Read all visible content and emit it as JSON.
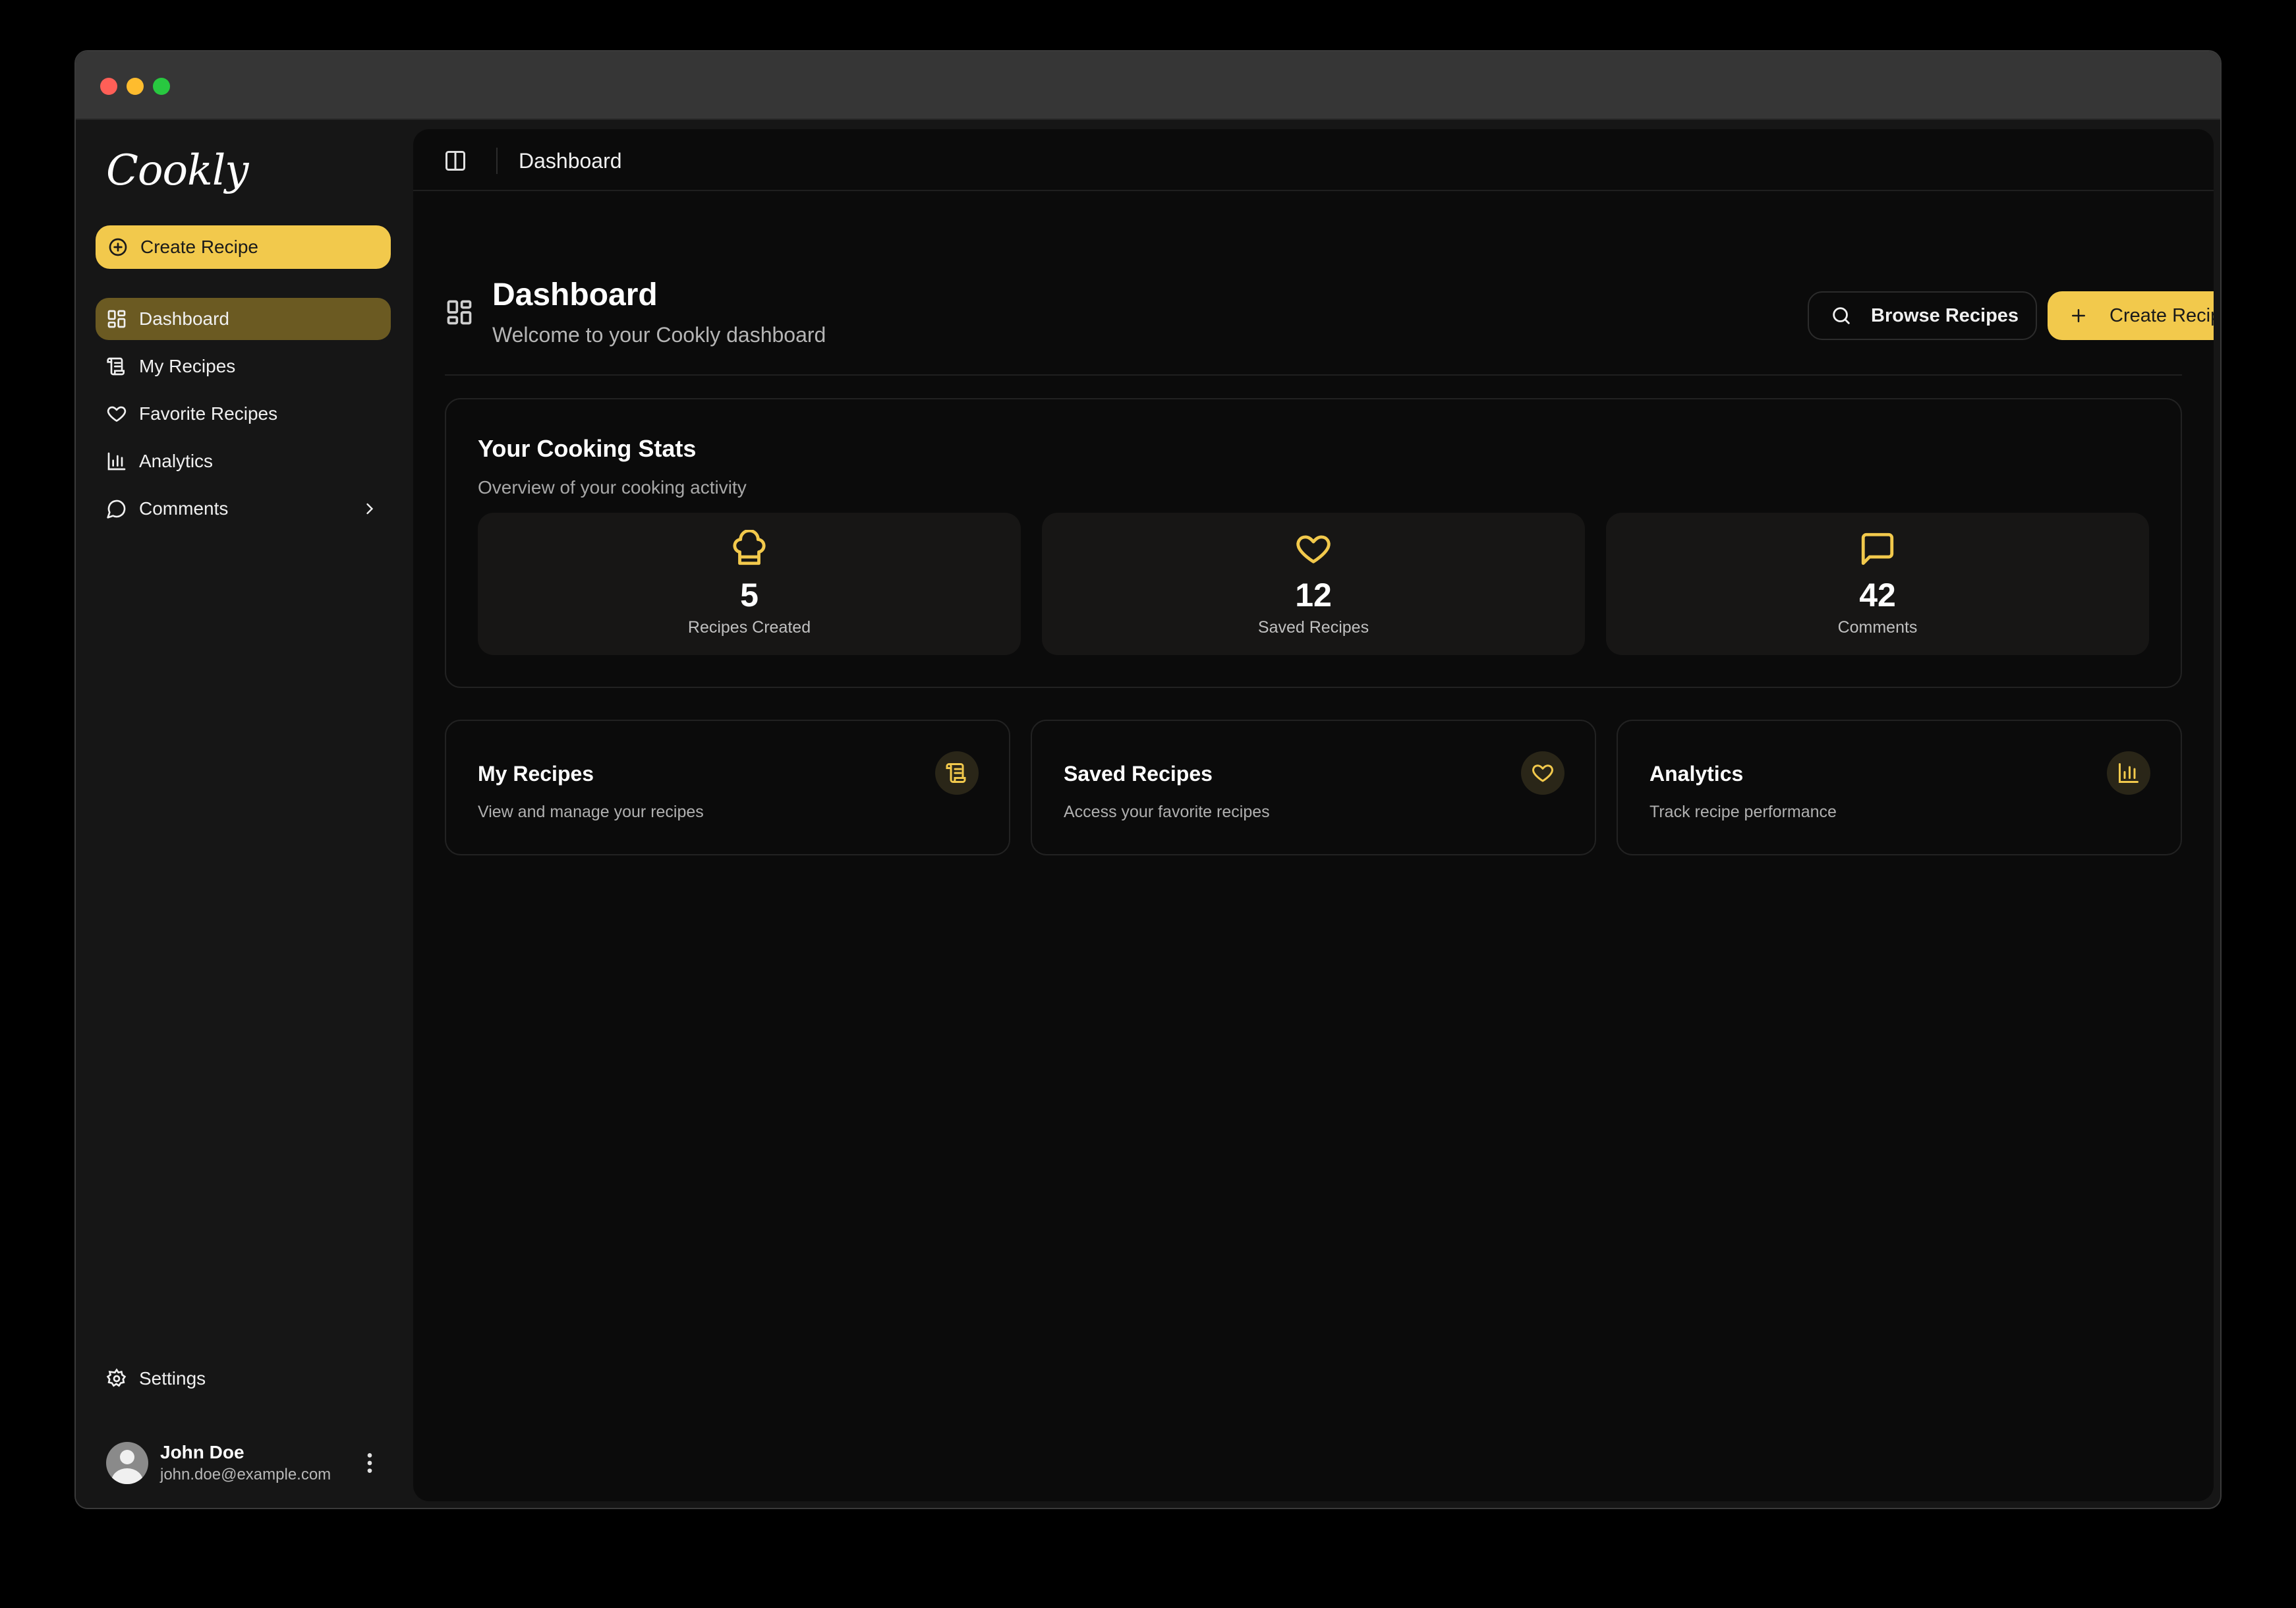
{
  "colors": {
    "accent": "#f2c94c",
    "active_nav": "#6b5a22",
    "background": "#0b0b0b",
    "sidebar": "#161616"
  },
  "sidebar": {
    "logo": "Cookly",
    "create_label": "Create Recipe",
    "items": [
      {
        "label": "Dashboard",
        "icon": "dashboard-icon",
        "active": true
      },
      {
        "label": "My Recipes",
        "icon": "scroll-icon",
        "active": false
      },
      {
        "label": "Favorite Recipes",
        "icon": "heart-icon",
        "active": false
      },
      {
        "label": "Analytics",
        "icon": "bar-chart-icon",
        "active": false
      },
      {
        "label": "Comments",
        "icon": "message-icon",
        "active": false,
        "has_submenu": true
      }
    ],
    "settings_label": "Settings",
    "user": {
      "name": "John Doe",
      "email": "john.doe@example.com"
    }
  },
  "topbar": {
    "breadcrumb": "Dashboard"
  },
  "header": {
    "title": "Dashboard",
    "subtitle": "Welcome to your Cookly dashboard",
    "browse_label": "Browse Recipes",
    "create_label": "Create Recipe"
  },
  "stats": {
    "title": "Your Cooking Stats",
    "subtitle": "Overview of your cooking activity",
    "items": [
      {
        "value": "5",
        "label": "Recipes Created",
        "icon": "chef-hat-icon"
      },
      {
        "value": "12",
        "label": "Saved Recipes",
        "icon": "heart-icon"
      },
      {
        "value": "42",
        "label": "Comments",
        "icon": "message-icon"
      }
    ]
  },
  "quick_cards": [
    {
      "title": "My Recipes",
      "subtitle": "View and manage your recipes",
      "icon": "scroll-icon"
    },
    {
      "title": "Saved Recipes",
      "subtitle": "Access your favorite recipes",
      "icon": "heart-icon"
    },
    {
      "title": "Analytics",
      "subtitle": "Track recipe performance",
      "icon": "bar-chart-icon"
    }
  ]
}
